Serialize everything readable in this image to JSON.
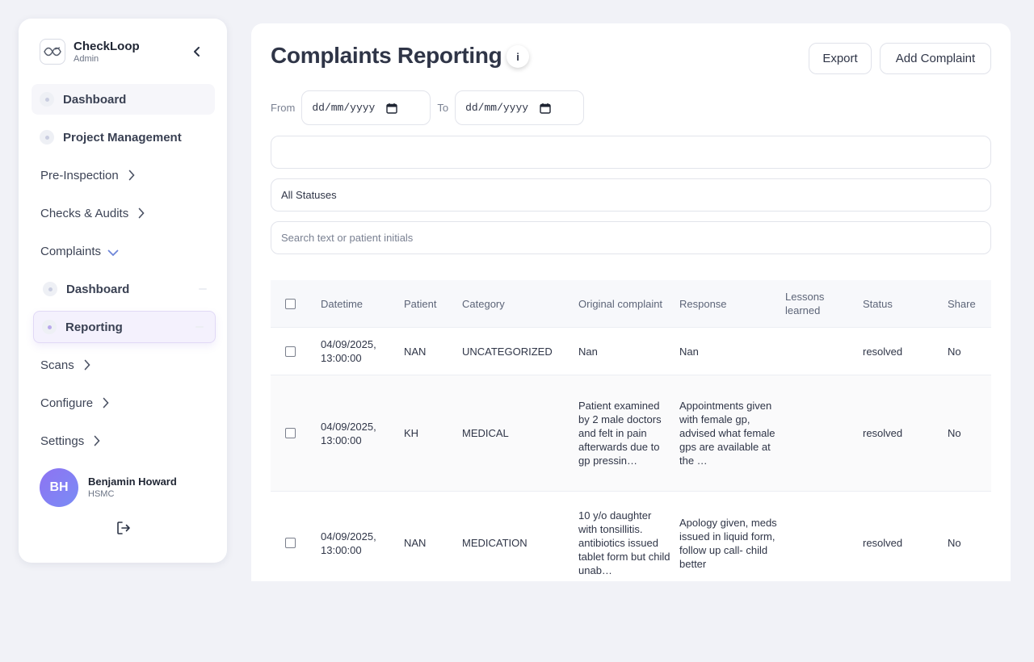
{
  "sidebar": {
    "brand_name": "CheckLoop",
    "brand_role": "Admin",
    "items": {
      "dashboard": "Dashboard",
      "project_management": "Project Management",
      "pre_inspection": "Pre-Inspection",
      "checks_audits": "Checks & Audits",
      "complaints": "Complaints",
      "complaints_dashboard": "Dashboard",
      "complaints_reporting": "Reporting",
      "scans": "Scans",
      "configure": "Configure",
      "settings": "Settings"
    },
    "user": {
      "initials": "BH",
      "name": "Benjamin Howard",
      "org": "HSMC"
    }
  },
  "header": {
    "title": "Complaints Reporting",
    "info_label": "i",
    "export_label": "Export",
    "add_label": "Add Complaint"
  },
  "filters": {
    "from_label": "From",
    "to_label": "To",
    "from_value": "dd/mm/yyyy",
    "to_value": "dd/mm/yyyy",
    "category_value": "",
    "status_value": "All Statuses",
    "search_placeholder": "Search text or patient initials"
  },
  "table": {
    "headers": {
      "datetime": "Datetime",
      "patient": "Patient",
      "category": "Category",
      "original_complaint": "Original complaint",
      "response": "Response",
      "lessons_learned": "Lessons learned",
      "status": "Status",
      "share": "Share"
    },
    "rows": [
      {
        "datetime": "04/09/2025, 13:00:00",
        "patient": "NAN",
        "category": "UNCATEGORIZED",
        "original": "Nan",
        "response": "Nan",
        "lessons": "",
        "status": "resolved",
        "share": "No"
      },
      {
        "datetime": "04/09/2025, 13:00:00",
        "patient": "KH",
        "category": "MEDICAL",
        "original": "Patient examined by 2 male doctors and felt in pain afterwards due to gp pressin…",
        "response": "Appointments given with female gp, advised what female gps are available at the …",
        "lessons": "",
        "status": "resolved",
        "share": "No"
      },
      {
        "datetime": "04/09/2025, 13:00:00",
        "patient": "NAN",
        "category": "MEDICATION",
        "original": "10 y/o daughter with tonsillitis. antibiotics issued tablet form but child unab…",
        "response": "Apology given, meds issued in liquid form, follow up call- child better",
        "lessons": "",
        "status": "resolved",
        "share": "No"
      }
    ]
  },
  "colors": {
    "accent": "#8e73f2",
    "background": "#f1f2f7"
  }
}
